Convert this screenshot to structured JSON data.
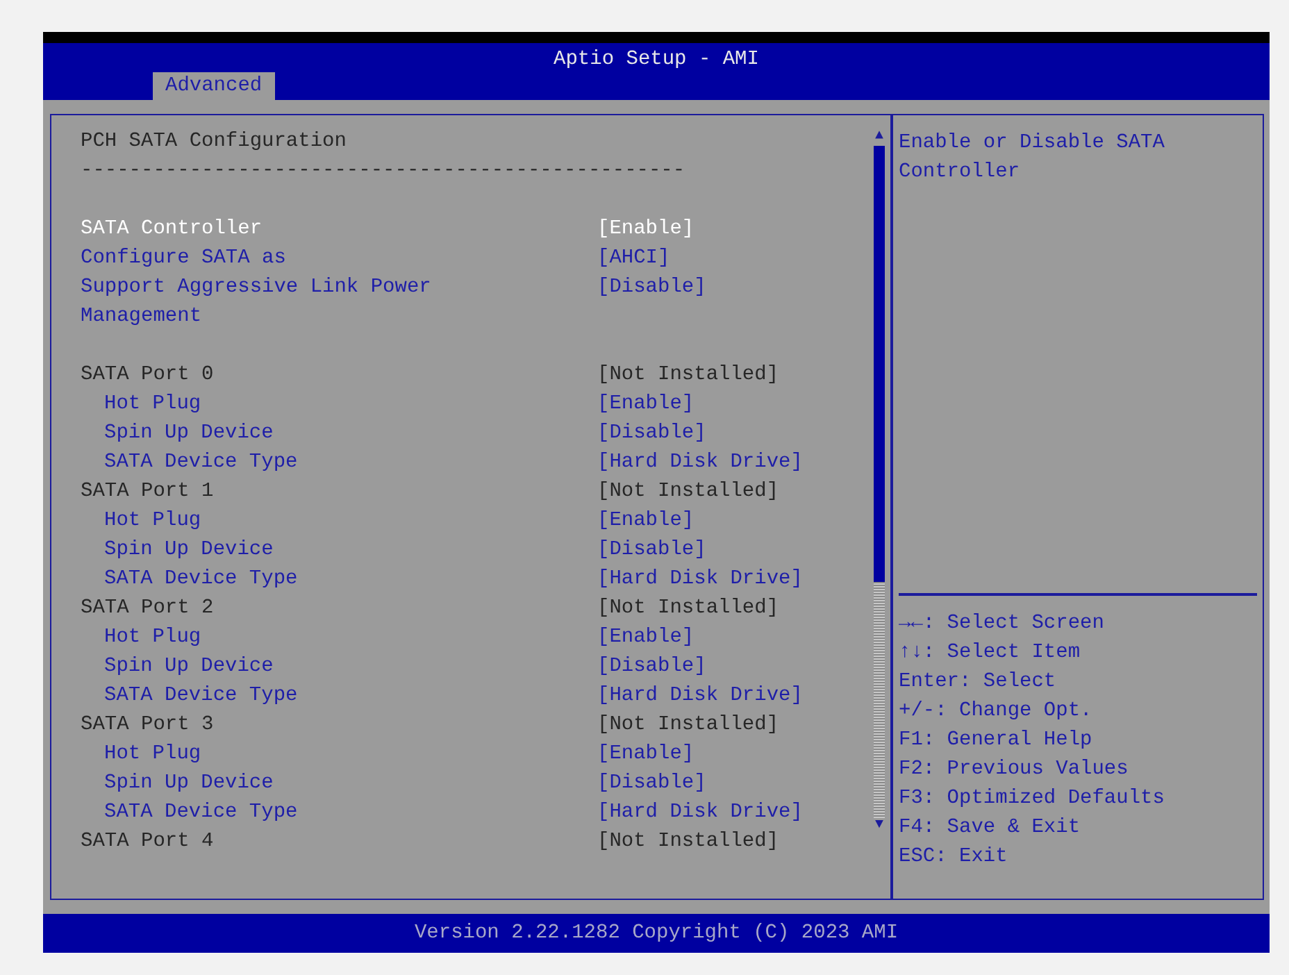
{
  "window": {
    "title": "Aptio Setup - AMI"
  },
  "tabs": [
    {
      "label": "Advanced",
      "selected": true
    }
  ],
  "page": {
    "title": "PCH SATA Configuration",
    "separator": "--------------------------------------------------",
    "sections": [
      {
        "items": [
          {
            "label": "SATA Controller",
            "value": "[Enable]",
            "kind": "option",
            "selected": true
          },
          {
            "label": "Configure SATA as",
            "value": "[AHCI]",
            "kind": "option",
            "selected": false
          },
          {
            "label": "Support Aggressive Link Power Management",
            "value": "[Disable]",
            "kind": "option",
            "selected": false
          }
        ]
      },
      {
        "items": [
          {
            "label": "SATA Port 0",
            "value": "[Not Installed]",
            "kind": "info",
            "selected": false,
            "children": [
              {
                "label": "Hot Plug",
                "value": "[Enable]",
                "kind": "option",
                "selected": false
              },
              {
                "label": "Spin Up Device",
                "value": "[Disable]",
                "kind": "option",
                "selected": false
              },
              {
                "label": "SATA Device Type",
                "value": "[Hard Disk Drive]",
                "kind": "option",
                "selected": false
              }
            ]
          },
          {
            "label": "SATA Port 1",
            "value": "[Not Installed]",
            "kind": "info",
            "selected": false,
            "children": [
              {
                "label": "Hot Plug",
                "value": "[Enable]",
                "kind": "option",
                "selected": false
              },
              {
                "label": "Spin Up Device",
                "value": "[Disable]",
                "kind": "option",
                "selected": false
              },
              {
                "label": "SATA Device Type",
                "value": "[Hard Disk Drive]",
                "kind": "option",
                "selected": false
              }
            ]
          },
          {
            "label": "SATA Port 2",
            "value": "[Not Installed]",
            "kind": "info",
            "selected": false,
            "children": [
              {
                "label": "Hot Plug",
                "value": "[Enable]",
                "kind": "option",
                "selected": false
              },
              {
                "label": "Spin Up Device",
                "value": "[Disable]",
                "kind": "option",
                "selected": false
              },
              {
                "label": "SATA Device Type",
                "value": "[Hard Disk Drive]",
                "kind": "option",
                "selected": false
              }
            ]
          },
          {
            "label": "SATA Port 3",
            "value": "[Not Installed]",
            "kind": "info",
            "selected": false,
            "children": [
              {
                "label": "Hot Plug",
                "value": "[Enable]",
                "kind": "option",
                "selected": false
              },
              {
                "label": "Spin Up Device",
                "value": "[Disable]",
                "kind": "option",
                "selected": false
              },
              {
                "label": "SATA Device Type",
                "value": "[Hard Disk Drive]",
                "kind": "option",
                "selected": false
              }
            ]
          },
          {
            "label": "SATA Port 4",
            "value": "[Not Installed]",
            "kind": "info",
            "selected": false
          }
        ]
      }
    ]
  },
  "scrollbar": {
    "up": "▲",
    "down": "▼"
  },
  "help": {
    "description": "Enable or Disable SATA Controller",
    "keys": [
      "→←: Select Screen",
      "↑↓: Select Item",
      "Enter: Select",
      "+/-: Change Opt.",
      "F1: General Help",
      "F2: Previous Values",
      "F3: Optimized Defaults",
      "F4: Save & Exit",
      "ESC: Exit"
    ]
  },
  "status_bar": "Version 2.22.1282 Copyright (C) 2023 AMI"
}
